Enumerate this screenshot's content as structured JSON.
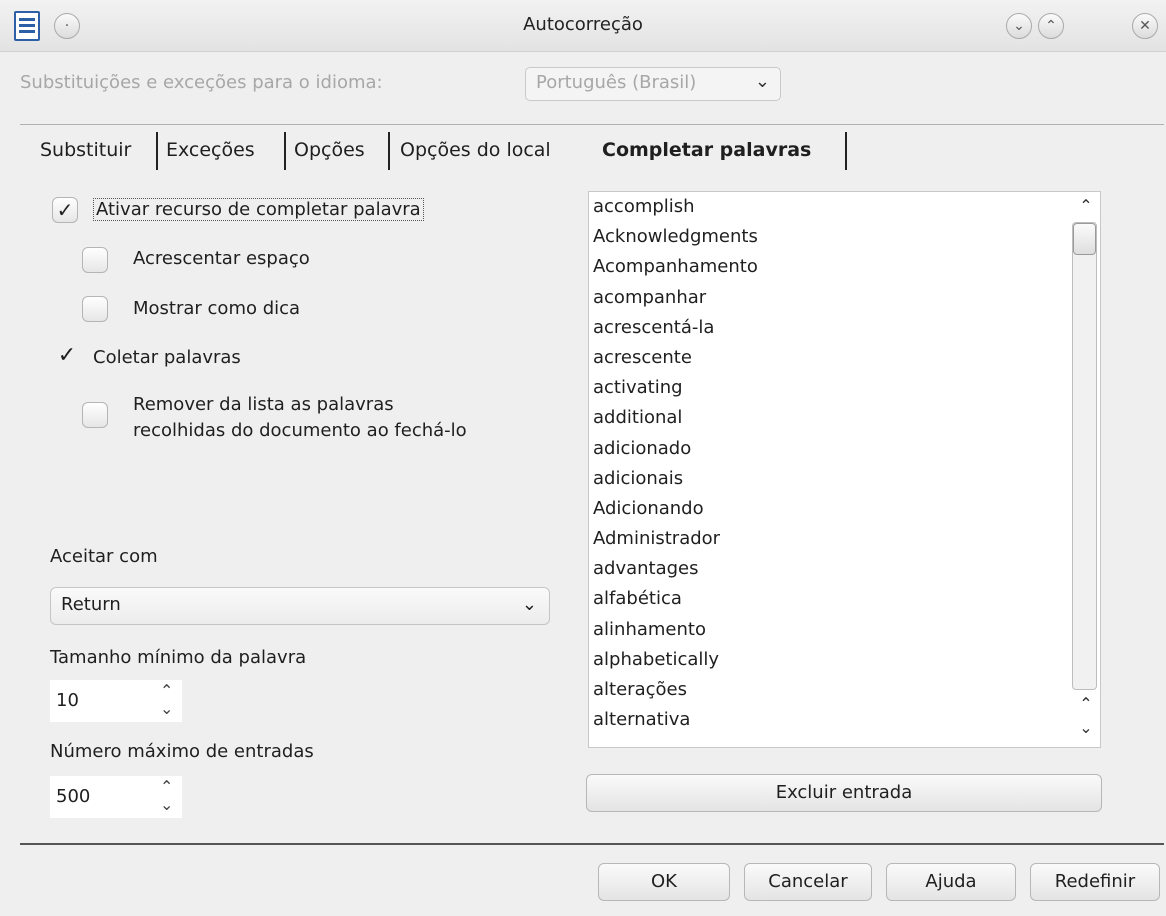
{
  "window": {
    "title": "Autocorreção",
    "minimize_glyph": "⌄",
    "maximize_glyph": "⌃",
    "close_glyph": "✕",
    "menu_glyph": "·"
  },
  "language": {
    "label": "Substituições e exceções para o idioma:",
    "value": "Português (Brasil)"
  },
  "tabs": [
    {
      "label": "Substituir"
    },
    {
      "label": "Exceções"
    },
    {
      "label": "Opções"
    },
    {
      "label": "Opções do local"
    },
    {
      "label": "Completar palavras",
      "active": true
    }
  ],
  "options": {
    "enable": {
      "label": "Ativar recurso de completar palavra",
      "checked": true
    },
    "append_space": {
      "label": "Acrescentar espaço",
      "checked": false
    },
    "show_tip": {
      "label": "Mostrar como dica",
      "checked": false
    },
    "collect": {
      "label": "Coletar palavras",
      "checked": true
    },
    "remove_line1": "Remover da lista as palavras",
    "remove_line2": "recolhidas do documento ao fechá-lo",
    "remove_checked": false,
    "check_glyph": "✓"
  },
  "accept": {
    "label": "Aceitar com",
    "value": "Return"
  },
  "min_length": {
    "label": "Tamanho mínimo da palavra",
    "value": "10"
  },
  "max_entries": {
    "label": "Número máximo de entradas",
    "value": "500"
  },
  "wordlist": {
    "items": [
      "accomplish",
      "Acknowledgments",
      "Acompanhamento",
      "acompanhar",
      "acrescentá-la",
      "acrescente",
      "activating",
      "additional",
      "adicionado",
      "adicionais",
      "Adicionando",
      "Administrador",
      "advantages",
      "alfabética",
      "alinhamento",
      "alphabetically",
      "alterações",
      "alternativa"
    ],
    "delete_label": "Excluir entrada"
  },
  "buttons": {
    "ok": "OK",
    "cancel": "Cancelar",
    "help": "Ajuda",
    "reset": "Redefinir"
  }
}
